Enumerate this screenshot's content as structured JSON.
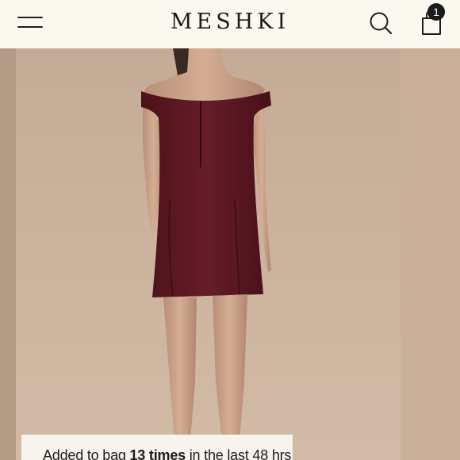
{
  "header": {
    "brand": "MESHKI",
    "cart_count": "1",
    "icons": {
      "menu": "hamburger-menu-icon",
      "search": "search-icon",
      "bag": "shopping-bag-icon"
    }
  },
  "product": {
    "image_alt": "Burgundy off-shoulder mini dress, back view",
    "dress_color": "#5e1b24"
  },
  "banner": {
    "prefix": "Added to bag ",
    "count": "13 times",
    "suffix": " in the last 48 hrs"
  }
}
